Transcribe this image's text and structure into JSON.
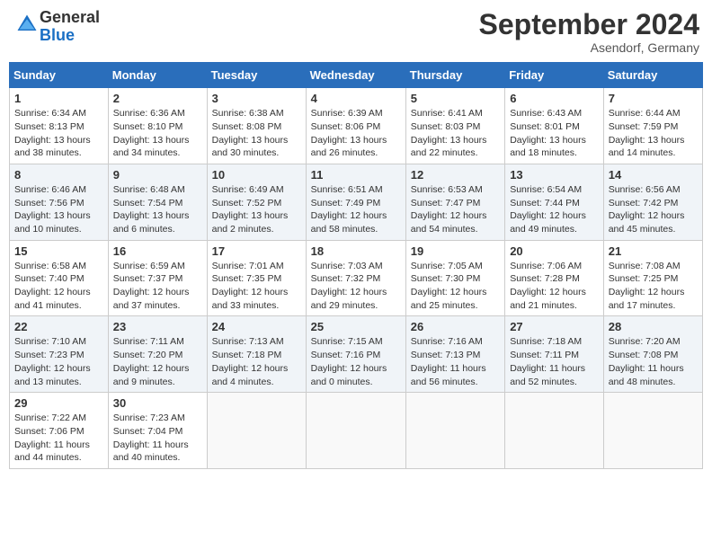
{
  "header": {
    "logo_general": "General",
    "logo_blue": "Blue",
    "month_title": "September 2024",
    "location": "Asendorf, Germany"
  },
  "weekdays": [
    "Sunday",
    "Monday",
    "Tuesday",
    "Wednesday",
    "Thursday",
    "Friday",
    "Saturday"
  ],
  "weeks": [
    [
      {
        "day": "1",
        "sunrise": "6:34 AM",
        "sunset": "8:13 PM",
        "daylight": "13 hours and 38 minutes."
      },
      {
        "day": "2",
        "sunrise": "6:36 AM",
        "sunset": "8:10 PM",
        "daylight": "13 hours and 34 minutes."
      },
      {
        "day": "3",
        "sunrise": "6:38 AM",
        "sunset": "8:08 PM",
        "daylight": "13 hours and 30 minutes."
      },
      {
        "day": "4",
        "sunrise": "6:39 AM",
        "sunset": "8:06 PM",
        "daylight": "13 hours and 26 minutes."
      },
      {
        "day": "5",
        "sunrise": "6:41 AM",
        "sunset": "8:03 PM",
        "daylight": "13 hours and 22 minutes."
      },
      {
        "day": "6",
        "sunrise": "6:43 AM",
        "sunset": "8:01 PM",
        "daylight": "13 hours and 18 minutes."
      },
      {
        "day": "7",
        "sunrise": "6:44 AM",
        "sunset": "7:59 PM",
        "daylight": "13 hours and 14 minutes."
      }
    ],
    [
      {
        "day": "8",
        "sunrise": "6:46 AM",
        "sunset": "7:56 PM",
        "daylight": "13 hours and 10 minutes."
      },
      {
        "day": "9",
        "sunrise": "6:48 AM",
        "sunset": "7:54 PM",
        "daylight": "13 hours and 6 minutes."
      },
      {
        "day": "10",
        "sunrise": "6:49 AM",
        "sunset": "7:52 PM",
        "daylight": "13 hours and 2 minutes."
      },
      {
        "day": "11",
        "sunrise": "6:51 AM",
        "sunset": "7:49 PM",
        "daylight": "12 hours and 58 minutes."
      },
      {
        "day": "12",
        "sunrise": "6:53 AM",
        "sunset": "7:47 PM",
        "daylight": "12 hours and 54 minutes."
      },
      {
        "day": "13",
        "sunrise": "6:54 AM",
        "sunset": "7:44 PM",
        "daylight": "12 hours and 49 minutes."
      },
      {
        "day": "14",
        "sunrise": "6:56 AM",
        "sunset": "7:42 PM",
        "daylight": "12 hours and 45 minutes."
      }
    ],
    [
      {
        "day": "15",
        "sunrise": "6:58 AM",
        "sunset": "7:40 PM",
        "daylight": "12 hours and 41 minutes."
      },
      {
        "day": "16",
        "sunrise": "6:59 AM",
        "sunset": "7:37 PM",
        "daylight": "12 hours and 37 minutes."
      },
      {
        "day": "17",
        "sunrise": "7:01 AM",
        "sunset": "7:35 PM",
        "daylight": "12 hours and 33 minutes."
      },
      {
        "day": "18",
        "sunrise": "7:03 AM",
        "sunset": "7:32 PM",
        "daylight": "12 hours and 29 minutes."
      },
      {
        "day": "19",
        "sunrise": "7:05 AM",
        "sunset": "7:30 PM",
        "daylight": "12 hours and 25 minutes."
      },
      {
        "day": "20",
        "sunrise": "7:06 AM",
        "sunset": "7:28 PM",
        "daylight": "12 hours and 21 minutes."
      },
      {
        "day": "21",
        "sunrise": "7:08 AM",
        "sunset": "7:25 PM",
        "daylight": "12 hours and 17 minutes."
      }
    ],
    [
      {
        "day": "22",
        "sunrise": "7:10 AM",
        "sunset": "7:23 PM",
        "daylight": "12 hours and 13 minutes."
      },
      {
        "day": "23",
        "sunrise": "7:11 AM",
        "sunset": "7:20 PM",
        "daylight": "12 hours and 9 minutes."
      },
      {
        "day": "24",
        "sunrise": "7:13 AM",
        "sunset": "7:18 PM",
        "daylight": "12 hours and 4 minutes."
      },
      {
        "day": "25",
        "sunrise": "7:15 AM",
        "sunset": "7:16 PM",
        "daylight": "12 hours and 0 minutes."
      },
      {
        "day": "26",
        "sunrise": "7:16 AM",
        "sunset": "7:13 PM",
        "daylight": "11 hours and 56 minutes."
      },
      {
        "day": "27",
        "sunrise": "7:18 AM",
        "sunset": "7:11 PM",
        "daylight": "11 hours and 52 minutes."
      },
      {
        "day": "28",
        "sunrise": "7:20 AM",
        "sunset": "7:08 PM",
        "daylight": "11 hours and 48 minutes."
      }
    ],
    [
      {
        "day": "29",
        "sunrise": "7:22 AM",
        "sunset": "7:06 PM",
        "daylight": "11 hours and 44 minutes."
      },
      {
        "day": "30",
        "sunrise": "7:23 AM",
        "sunset": "7:04 PM",
        "daylight": "11 hours and 40 minutes."
      },
      null,
      null,
      null,
      null,
      null
    ]
  ]
}
